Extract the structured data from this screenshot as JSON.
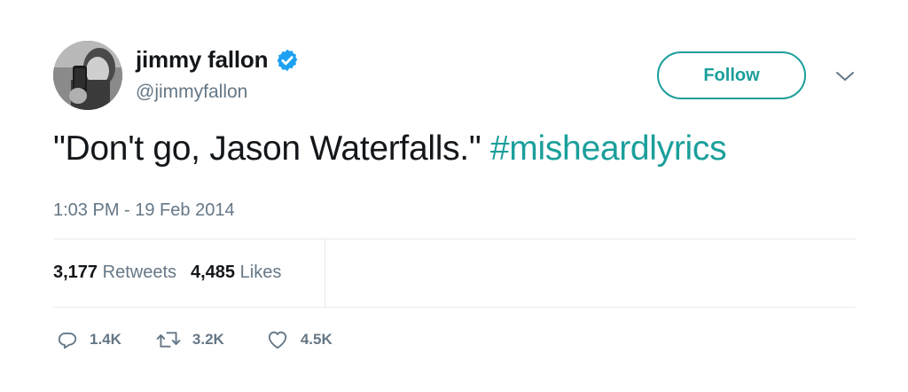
{
  "user": {
    "display_name": "jimmy fallon",
    "handle": "@jimmyfallon",
    "verified": true,
    "verified_color": "#1da1f2"
  },
  "follow_button": {
    "label": "Follow",
    "accent_color": "#1b9f9b"
  },
  "menu": {
    "icon": "chevron-down-icon"
  },
  "tweet": {
    "text": "\"Don't go, Jason Waterfalls.\" ",
    "hashtag": "#misheardlyrics",
    "timestamp": "1:03 PM - 19 Feb 2014"
  },
  "stats": {
    "retweets_count": "3,177",
    "retweets_label": "Retweets",
    "likes_count": "4,485",
    "likes_label": "Likes"
  },
  "actions": {
    "reply": {
      "icon": "reply-icon",
      "count": "1.4K"
    },
    "retweet": {
      "icon": "retweet-icon",
      "count": "3.2K"
    },
    "like": {
      "icon": "heart-icon",
      "count": "4.5K"
    }
  }
}
